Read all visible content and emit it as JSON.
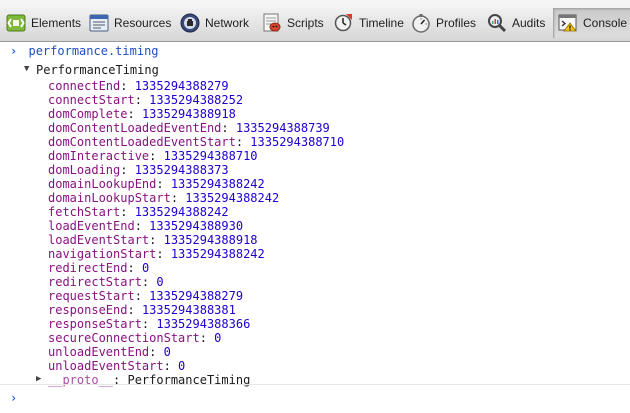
{
  "tabs": [
    {
      "label": "Elements"
    },
    {
      "label": "Resources"
    },
    {
      "label": "Network"
    },
    {
      "label": "Scripts"
    },
    {
      "label": "Timeline"
    },
    {
      "label": "Profiles"
    },
    {
      "label": "Audits"
    },
    {
      "label": "Console"
    }
  ],
  "console": {
    "command": "performance.timing",
    "object_name": "PerformanceTiming",
    "properties": [
      {
        "name": "connectEnd",
        "value": "1335294388279"
      },
      {
        "name": "connectStart",
        "value": "1335294388252"
      },
      {
        "name": "domComplete",
        "value": "1335294388918"
      },
      {
        "name": "domContentLoadedEventEnd",
        "value": "1335294388739"
      },
      {
        "name": "domContentLoadedEventStart",
        "value": "1335294388710"
      },
      {
        "name": "domInteractive",
        "value": "1335294388710"
      },
      {
        "name": "domLoading",
        "value": "1335294388373"
      },
      {
        "name": "domainLookupEnd",
        "value": "1335294388242"
      },
      {
        "name": "domainLookupStart",
        "value": "1335294388242"
      },
      {
        "name": "fetchStart",
        "value": "1335294388242"
      },
      {
        "name": "loadEventEnd",
        "value": "1335294388930"
      },
      {
        "name": "loadEventStart",
        "value": "1335294388918"
      },
      {
        "name": "navigationStart",
        "value": "1335294388242"
      },
      {
        "name": "redirectEnd",
        "value": "0"
      },
      {
        "name": "redirectStart",
        "value": "0"
      },
      {
        "name": "requestStart",
        "value": "1335294388279"
      },
      {
        "name": "responseEnd",
        "value": "1335294388381"
      },
      {
        "name": "responseStart",
        "value": "1335294388366"
      },
      {
        "name": "secureConnectionStart",
        "value": "0"
      },
      {
        "name": "unloadEventEnd",
        "value": "0"
      },
      {
        "name": "unloadEventStart",
        "value": "0"
      }
    ],
    "proto_name": "__proto__",
    "proto_value": "PerformanceTiming",
    "prompt_symbol": "›"
  },
  "icons": {
    "elements": "elements-icon",
    "resources": "resources-icon",
    "network": "network-icon",
    "scripts": "scripts-icon",
    "timeline": "timeline-icon",
    "profiles": "profiles-icon",
    "audits": "audits-icon",
    "console": "console-icon"
  },
  "colors": {
    "command": "#1d4fc4",
    "property_name": "#881280",
    "property_value": "#1c00cf"
  }
}
